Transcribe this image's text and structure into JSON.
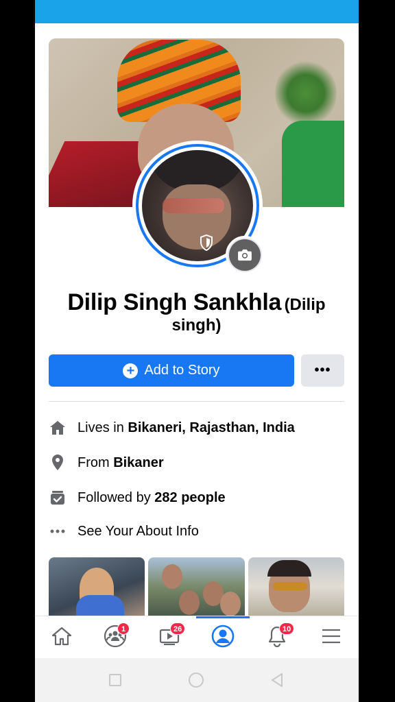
{
  "profile": {
    "name": "Dilip Singh Sankhla",
    "alternate_name": "(Dilip singh)"
  },
  "actions": {
    "add_to_story": "Add to Story",
    "more": "•••"
  },
  "details": {
    "lives_prefix": "Lives in",
    "lives_value": "Bikaneri, Rajasthan, India",
    "from_prefix": "From",
    "from_value": "Bikaner",
    "followed_prefix": "Followed by",
    "followed_value": "282 people",
    "about_label": "See Your About Info"
  },
  "tabs": {
    "groups_badge": "1",
    "watch_badge": "26",
    "notifications_badge": "10"
  },
  "icons": {
    "cover_camera": "camera-icon",
    "avatar_camera": "camera-icon",
    "profile_guard": "shield-icon",
    "lives": "house-icon",
    "from": "location-pin-icon",
    "followed": "followers-icon",
    "about": "more-dots-icon",
    "home": "home-icon",
    "groups": "groups-icon",
    "watch": "watch-icon",
    "profile": "profile-icon",
    "notifications": "bell-icon",
    "menu": "hamburger-menu-icon"
  },
  "colors": {
    "status_bar": "#1aa3e8",
    "primary": "#1877f2",
    "badge": "#f02849"
  }
}
